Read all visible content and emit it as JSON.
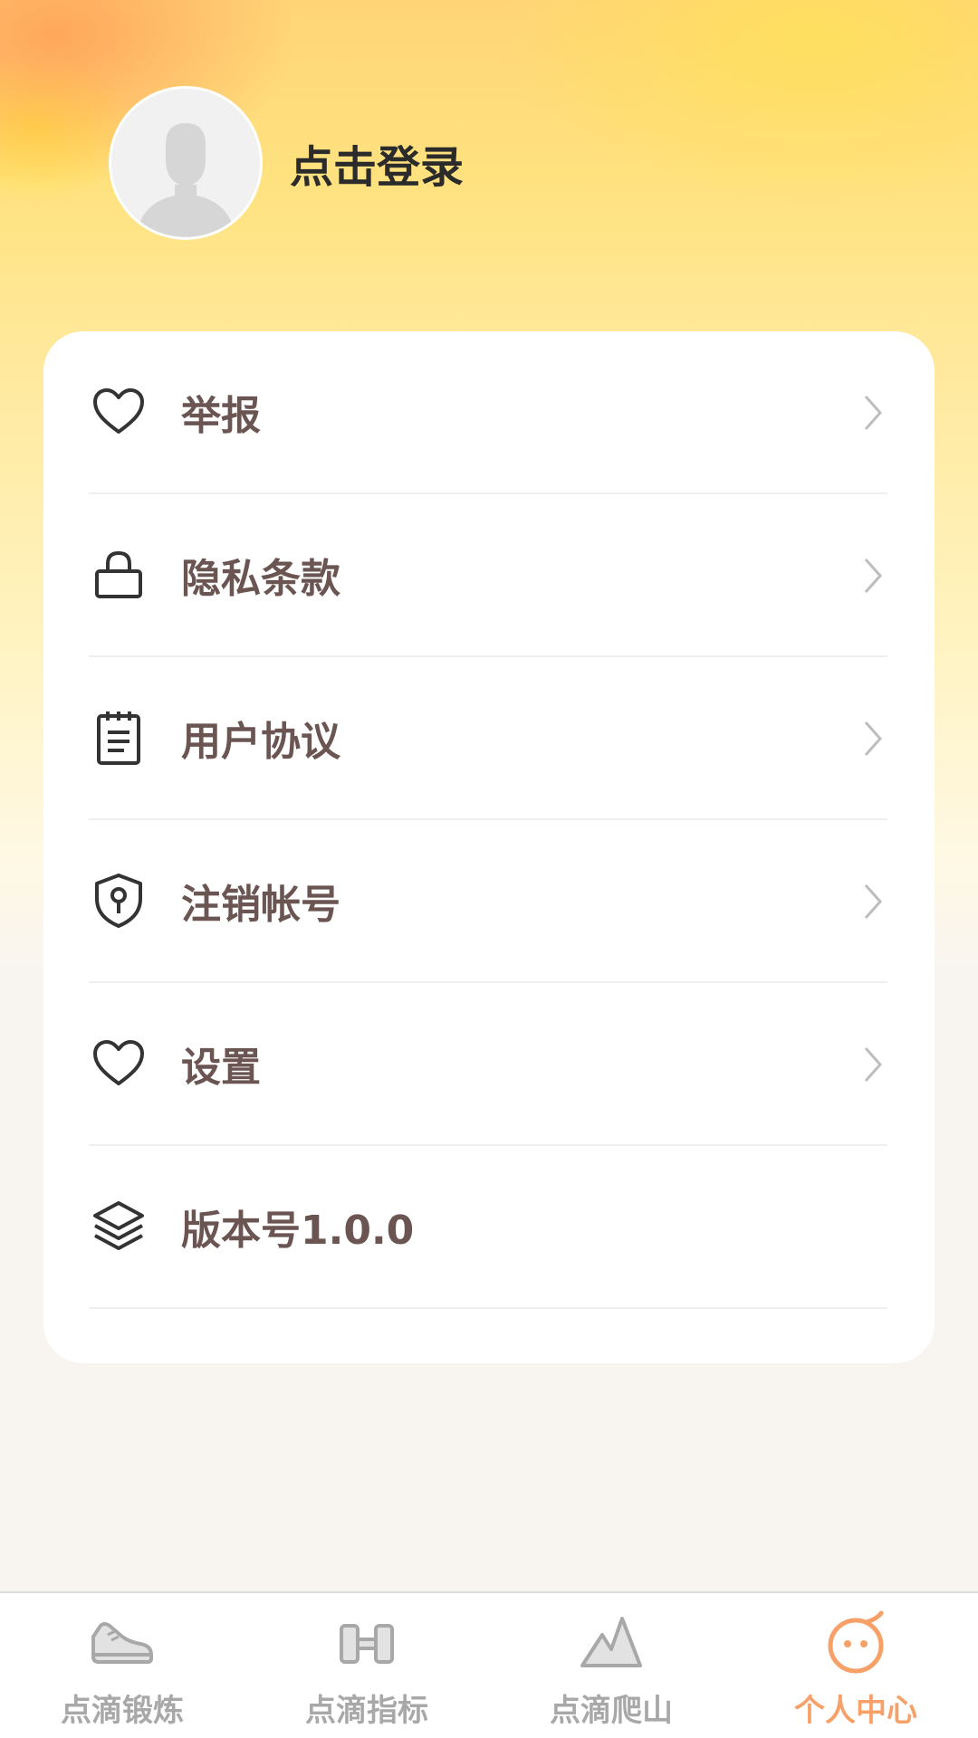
{
  "profile": {
    "login_label": "点击登录"
  },
  "menu": {
    "items": [
      {
        "label": "举报",
        "icon": "heart-icon"
      },
      {
        "label": "隐私条款",
        "icon": "lock-icon"
      },
      {
        "label": "用户协议",
        "icon": "notepad-icon"
      },
      {
        "label": "注销帐号",
        "icon": "shield-keyhole-icon"
      },
      {
        "label": "设置",
        "icon": "heart-icon"
      },
      {
        "label": "版本号1.0.0",
        "icon": "layers-icon"
      }
    ]
  },
  "tabbar": {
    "tabs": [
      {
        "label": "点滴锻炼",
        "icon": "sneaker-icon"
      },
      {
        "label": "点滴指标",
        "icon": "dumbbell-icon"
      },
      {
        "label": "点滴爬山",
        "icon": "mountain-icon"
      },
      {
        "label": "个人中心",
        "icon": "smiley-face-icon"
      }
    ],
    "active_index": 3
  },
  "colors": {
    "accent": "#f7a168",
    "menu_text": "#6b5552",
    "tab_inactive": "#a8a8a8"
  }
}
